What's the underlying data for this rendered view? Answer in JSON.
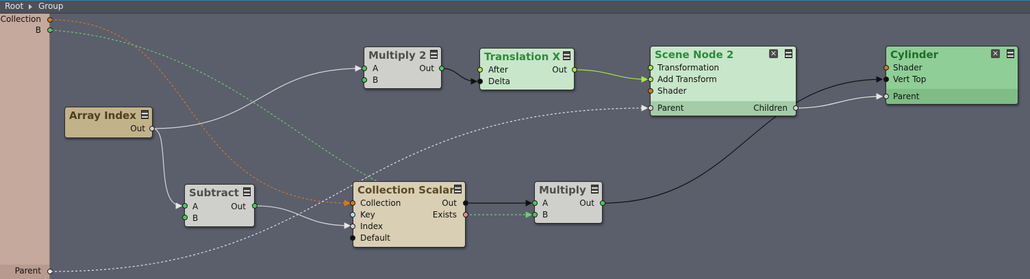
{
  "breadcrumb": {
    "root": "Root",
    "group": "Group"
  },
  "group_inputs": {
    "collection": "Collection",
    "b": "B"
  },
  "group_outputs": {
    "parent": "Parent"
  },
  "nodes": {
    "array_index": {
      "title": "Array Index",
      "out": "Out"
    },
    "multiply2": {
      "title": "Multiply 2",
      "a": "A",
      "b": "B",
      "out": "Out"
    },
    "translation_x": {
      "title": "Translation X",
      "after": "After",
      "delta": "Delta",
      "out": "Out"
    },
    "scene_node2": {
      "title": "Scene Node 2",
      "transformation": "Transformation",
      "add_transform": "Add Transform",
      "shader": "Shader",
      "parent": "Parent",
      "children": "Children"
    },
    "cylinder": {
      "title": "Cylinder",
      "shader": "Shader",
      "vert_top": "Vert Top",
      "parent": "Parent"
    },
    "subtract": {
      "title": "Subtract",
      "a": "A",
      "b": "B",
      "out": "Out"
    },
    "collection_scalar": {
      "title": "Collection Scalar",
      "collection": "Collection",
      "key": "Key",
      "index": "Index",
      "default": "Default",
      "out": "Out",
      "exists": "Exists"
    },
    "multiply": {
      "title": "Multiply",
      "a": "A",
      "b": "B",
      "out": "Out"
    }
  },
  "icons": {
    "menu": "node-menu-icon",
    "close": "close-box-icon",
    "breadcrumb_sep": "triangle-right-icon"
  },
  "colors": {
    "canvas": "#5b5e6b",
    "port_orange": "#d67a1c",
    "port_green": "#4fc65a",
    "port_lime": "#a6e64a",
    "port_black": "#111111",
    "port_pink": "#e88a8a",
    "port_cyan": "#a8e4ea",
    "port_gray": "#cfcfcf",
    "wire_white": "#e6e6e6"
  }
}
